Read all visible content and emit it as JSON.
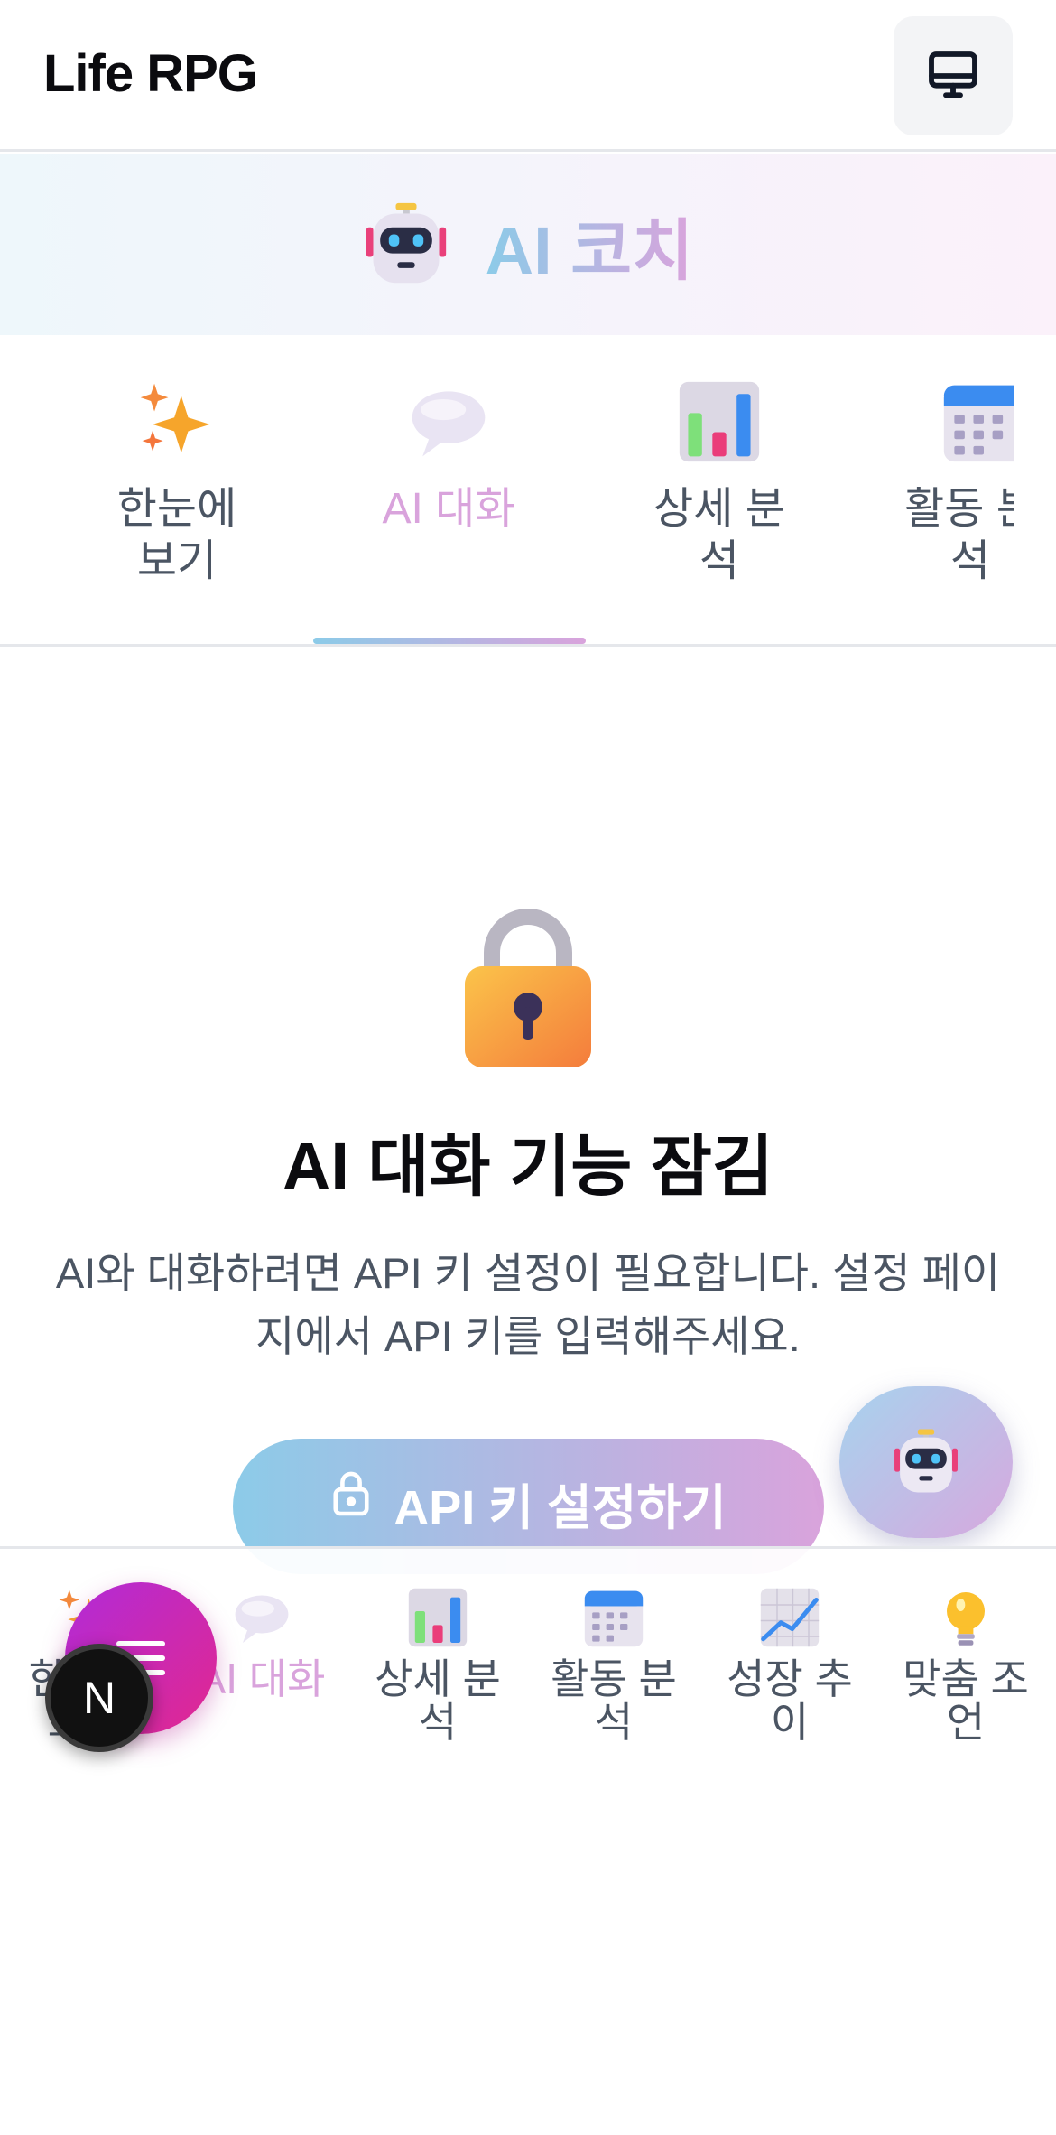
{
  "header": {
    "app_title": "Life RPG",
    "device_icon": "monitor-icon"
  },
  "banner": {
    "icon": "robot-icon",
    "title": "AI 코치"
  },
  "tabs": [
    {
      "label": "한눈에 보기",
      "icon": "sparkles-icon",
      "active": false
    },
    {
      "label": "AI 대화",
      "icon": "speech-bubble-icon",
      "active": true
    },
    {
      "label": "상세 분석",
      "icon": "bar-chart-icon",
      "active": false
    },
    {
      "label": "활동 분석",
      "icon": "calendar-icon",
      "active": false
    }
  ],
  "locked": {
    "icon": "lock-icon",
    "title": "AI 대화 기능 잠김",
    "description": "AI와 대화하려면 API 키 설정이 필요합니다. 설정 페이지에서 API 키를 입력해주세요.",
    "button_label": "API 키 설정하기"
  },
  "floating": {
    "robot_icon": "robot-icon",
    "menu_icon": "menu-icon",
    "badge_letter": "N"
  },
  "bottom_nav": [
    {
      "label": "한눈에 보기",
      "icon": "sparkles-icon",
      "active": false
    },
    {
      "label": "AI 대화",
      "icon": "speech-bubble-icon",
      "active": true
    },
    {
      "label": "상세 분석",
      "icon": "bar-chart-icon",
      "active": false
    },
    {
      "label": "활동 분석",
      "icon": "calendar-icon",
      "active": false
    },
    {
      "label": "성장 추이",
      "icon": "line-chart-icon",
      "active": false
    },
    {
      "label": "맞춤 조언",
      "icon": "light-bulb-icon",
      "active": false
    }
  ],
  "colors": {
    "accent_start": "#8ccbe8",
    "accent_end": "#d9a3dc",
    "menu_fab_start": "#b12ad8",
    "menu_fab_end": "#e2288f"
  }
}
